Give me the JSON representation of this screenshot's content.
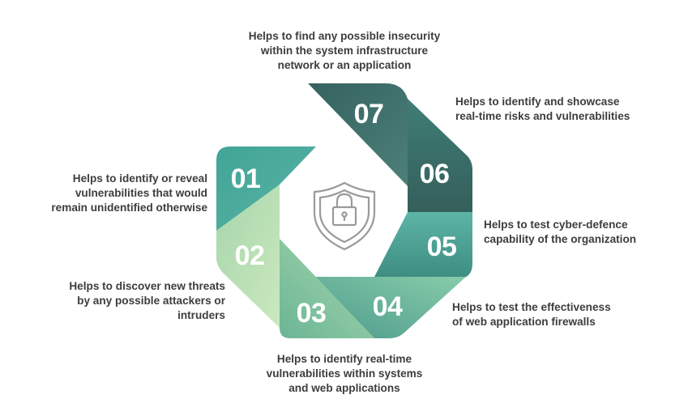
{
  "steps": [
    {
      "number": "01",
      "lines": [
        "Helps to identify or reveal",
        "vulnerabilities that would",
        "remain unidentified otherwise"
      ]
    },
    {
      "number": "02",
      "lines": [
        "Helps to discover new threats",
        "by any possible attackers or",
        "intruders"
      ]
    },
    {
      "number": "03",
      "lines": [
        "Helps to identify real-time",
        "vulnerabilities within systems",
        "and web applications"
      ]
    },
    {
      "number": "04",
      "lines": [
        "Helps to test the effectiveness",
        "of web application firewalls"
      ]
    },
    {
      "number": "05",
      "lines": [
        "Helps to test cyber-defence",
        "capability of the organization"
      ]
    },
    {
      "number": "06",
      "lines": [
        "Helps to identify and showcase",
        "real-time risks and vulnerabilities"
      ]
    },
    {
      "number": "07",
      "lines": [
        "Helps to find any possible insecurity",
        "within the system infrastructure",
        "network or an application"
      ]
    }
  ],
  "center_icon": "shield-lock-icon",
  "colors": {
    "dark_teal": "#3f6e6c",
    "teal": "#4aa79d",
    "mid_teal": "#5bb6a6",
    "green": "#7fc8a2",
    "light_green": "#c4e6b4",
    "text": "#3d3d3d",
    "icon": "#9a9a9a"
  }
}
